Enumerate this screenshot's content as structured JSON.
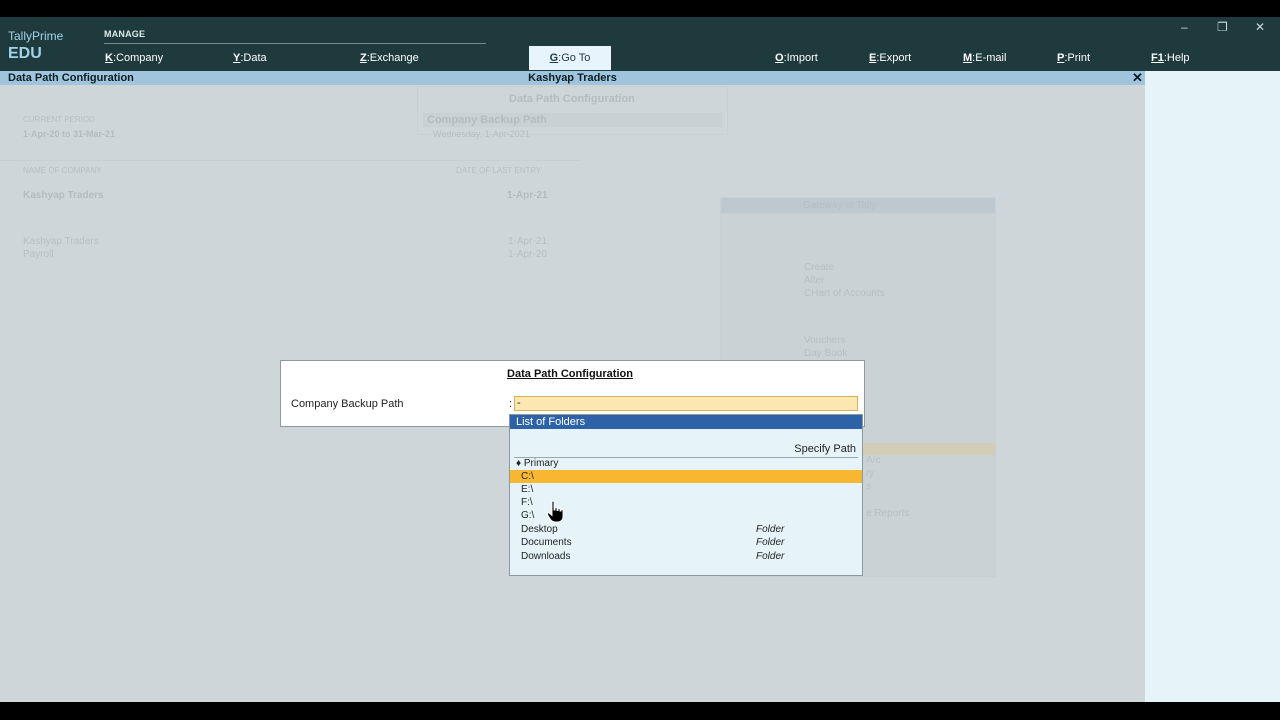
{
  "header": {
    "brand_name": "TallyPrime",
    "brand_edition": "EDU",
    "section_label": "MANAGE",
    "menu": [
      {
        "key": "K",
        "label": "Company"
      },
      {
        "key": "Y",
        "label": "Data"
      },
      {
        "key": "Z",
        "label": "Exchange"
      },
      {
        "key": "G",
        "label": "Go To"
      },
      {
        "key": "O",
        "label": "Import"
      },
      {
        "key": "E",
        "label": "Export"
      },
      {
        "key": "M",
        "label": "E-mail"
      },
      {
        "key": "P",
        "label": "Print"
      },
      {
        "key": "F1",
        "label": "Help"
      }
    ],
    "window_controls": {
      "minimize": "–",
      "restore": "❐",
      "close": "✕"
    }
  },
  "titlebar": {
    "screen_title": "Data Path Configuration",
    "company": "Kashyap Traders",
    "close": "✕"
  },
  "background": {
    "popup_title": "Data Path Configuration",
    "popup_field": "Company Backup Path",
    "current_period_label": "CURRENT PERIOD",
    "current_period": "1-Apr-20 to 31-Mar-21",
    "current_date": "Wednesday, 1-Apr-2021",
    "name_of_company_label": "NAME OF COMPANY",
    "date_of_last_entry_label": "DATE OF LAST ENTRY",
    "selected_company": "Kashyap Traders",
    "selected_company_date": "1-Apr-21",
    "companies": [
      {
        "name": "Kashyap Traders",
        "date": "1-Apr-21"
      },
      {
        "name": "Payroll",
        "date": "1-Apr-20"
      }
    ],
    "gateway_title": "Gateway of Tally",
    "gateway_items": [
      "Create",
      "Alter",
      "CHart of Accounts",
      "Vouchers",
      "Day Book",
      "A/c",
      "ry",
      "s",
      "e Reports"
    ]
  },
  "dialog": {
    "title": "Data Path Configuration",
    "field_label": "Company Backup Path",
    "colon": ":",
    "field_value": "-"
  },
  "folder_list": {
    "header": "List of Folders",
    "specify_path": "Specify Path",
    "primary_label": "♦ Primary",
    "items": [
      {
        "name": "C:\\",
        "type": "",
        "selected": true
      },
      {
        "name": "E:\\",
        "type": ""
      },
      {
        "name": "F:\\",
        "type": ""
      },
      {
        "name": "G:\\",
        "type": ""
      },
      {
        "name": "Desktop",
        "type": "Folder"
      },
      {
        "name": "Documents",
        "type": "Folder"
      },
      {
        "name": "Downloads",
        "type": "Folder"
      }
    ]
  },
  "colors": {
    "header_bg": "#1f3a3d",
    "titlebar_bg": "#9fc4dc",
    "list_header_bg": "#2d62a8",
    "selection": "#f7b731",
    "input_bg": "#fbe7b2"
  }
}
